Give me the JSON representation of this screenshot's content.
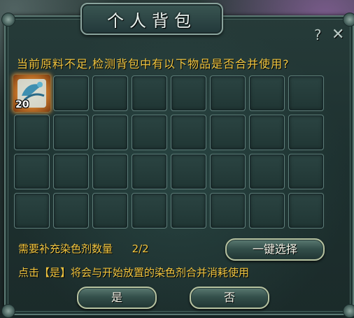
{
  "window": {
    "title": "个人背包"
  },
  "header": {
    "help_icon": "?",
    "close_icon": "✕"
  },
  "prompt": "当前原料不足,检测背包中有以下物品是否合并使用?",
  "inventory": {
    "rows": 4,
    "cols": 8,
    "items": [
      {
        "slot": 0,
        "name": "dye-item-icon",
        "count": "20"
      }
    ]
  },
  "requirement": {
    "label": "需要补充染色剂数量",
    "value": "2/2"
  },
  "one_click_select_label": "一键选择",
  "confirm_note": "点击【是】将会与开始放置的染色剂合并消耗使用",
  "buttons": {
    "yes": "是",
    "no": "否"
  },
  "colors": {
    "accent_text": "#f2c640",
    "panel": "#1d302f",
    "slot_border": "#5f7f79"
  }
}
